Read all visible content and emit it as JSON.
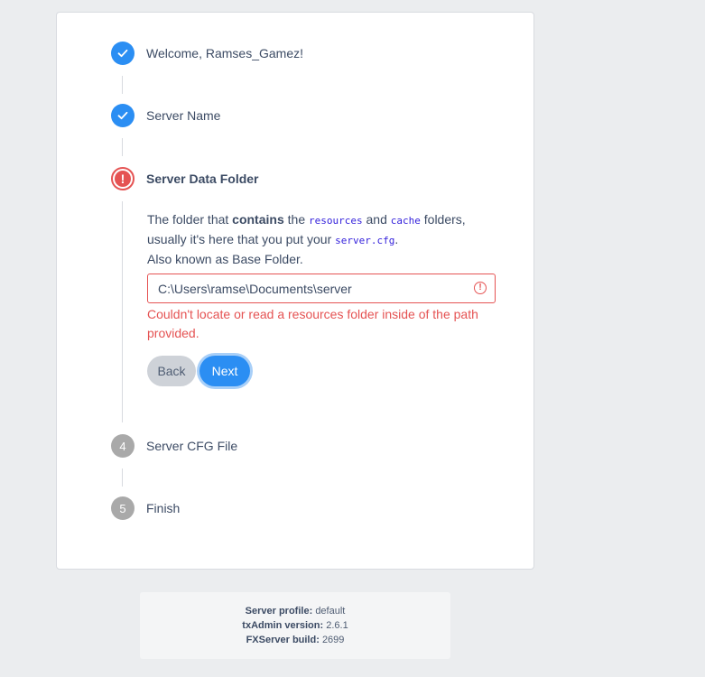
{
  "steps": [
    {
      "label": "Welcome, Ramses_Gamez!",
      "state": "done"
    },
    {
      "label": "Server Name",
      "state": "done"
    },
    {
      "label": "Server Data Folder",
      "state": "error"
    },
    {
      "number": "4",
      "label": "Server CFG File",
      "state": "pending"
    },
    {
      "number": "5",
      "label": "Finish",
      "state": "pending"
    }
  ],
  "data_folder": {
    "desc_part1": "The folder that ",
    "desc_bold": "contains",
    "desc_part2": " the ",
    "code_resources": "resources",
    "desc_and": " and ",
    "code_cache": "cache",
    "desc_part3": " folders,",
    "desc_line2": "usually it's here that you put your ",
    "code_server_cfg": "server.cfg",
    "desc_period": ".",
    "desc_line3": "Also known as Base Folder.",
    "input_value": "C:\\Users\\ramse\\Documents\\server",
    "error_message": "Couldn't locate or read a resources folder inside of the path provided.",
    "back_label": "Back",
    "next_label": "Next"
  },
  "footer": {
    "profile_label": "Server profile:",
    "profile_value": "default",
    "txadmin_label": "txAdmin version:",
    "txadmin_value": "2.6.1",
    "fxserver_label": "FXServer build:",
    "fxserver_value": "2699"
  },
  "colors": {
    "primary": "#2b8ef3",
    "danger": "#e55353",
    "pending": "#a9a9a9"
  }
}
